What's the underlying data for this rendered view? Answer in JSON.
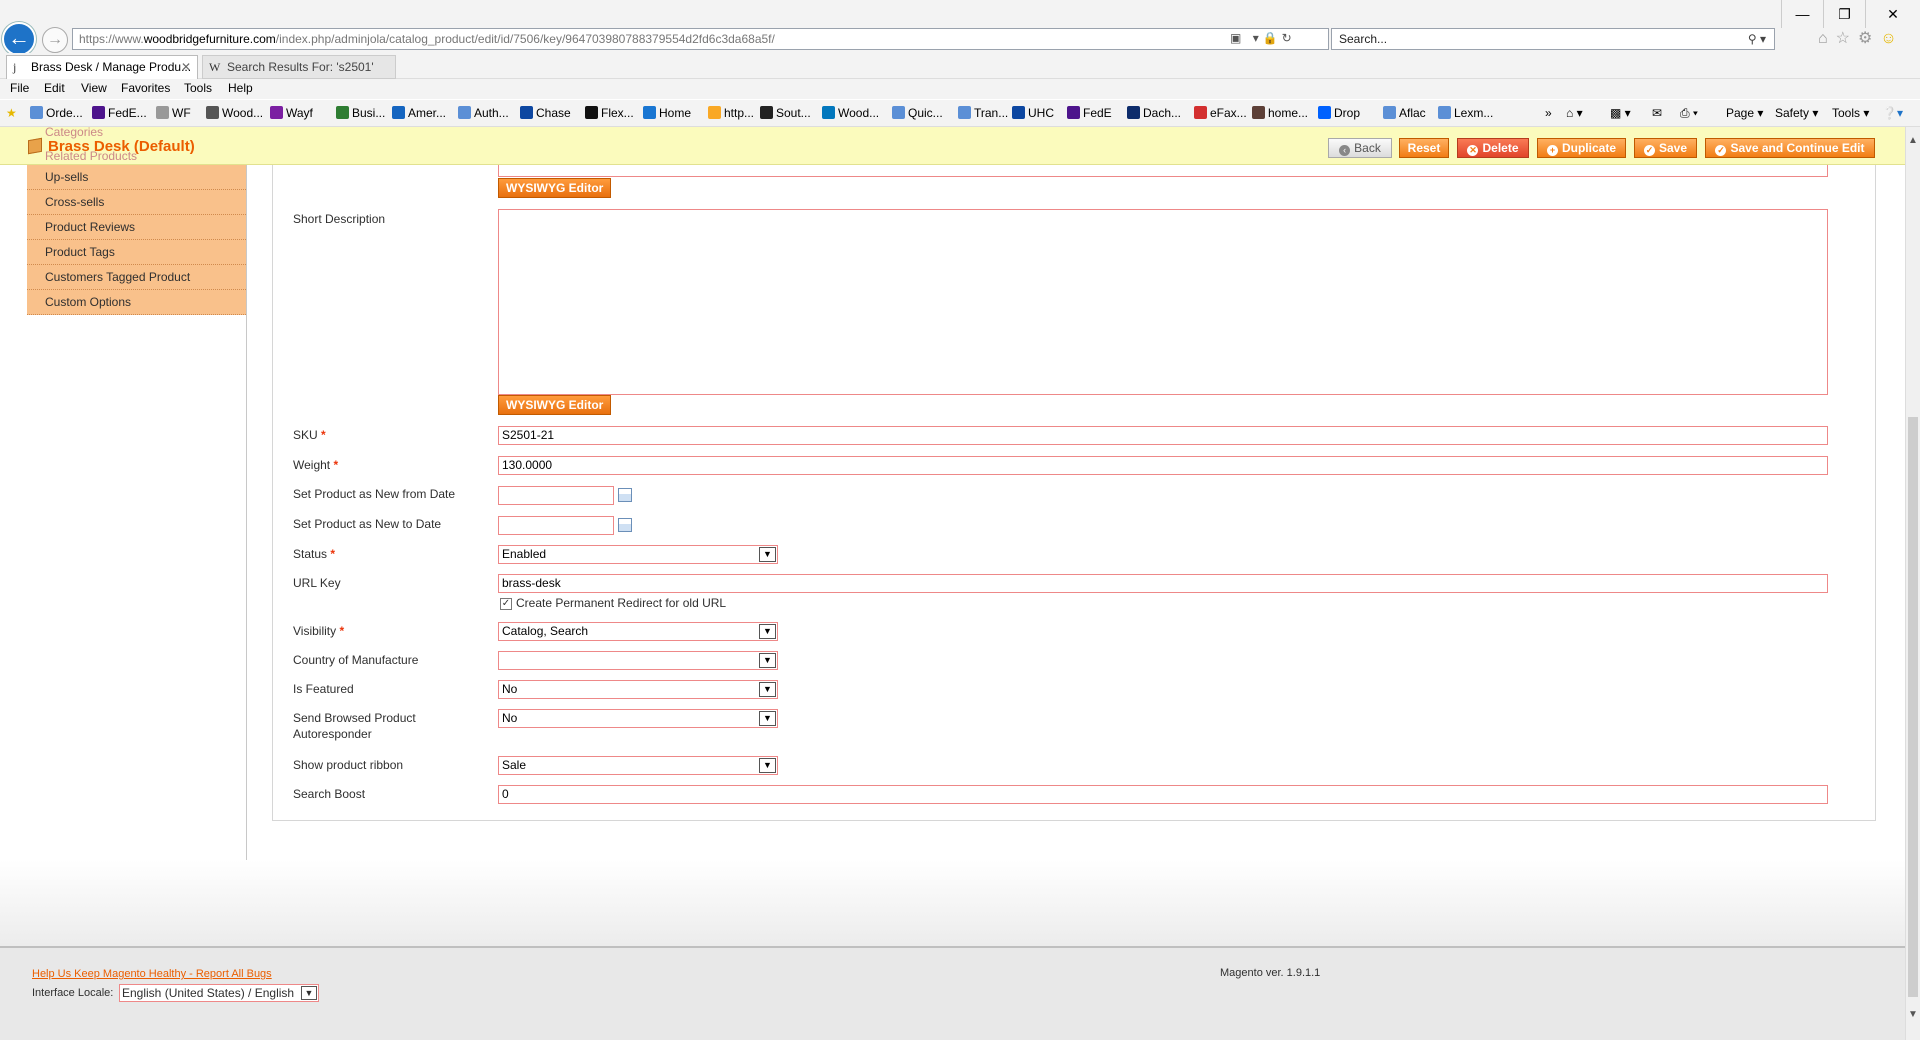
{
  "browser": {
    "url_prefix": "https://www.",
    "url_host": "woodbridgefurniture.com",
    "url_path": "/index.php/adminjola/catalog_product/edit/id/7506/key/964703980788379554d2fd6c3da68a5f/",
    "search_placeholder": "Search...",
    "tabs": [
      {
        "label": "Brass Desk / Manage Produ...",
        "favicon": "j"
      },
      {
        "label": "Search Results For: 's2501'",
        "favicon": "W"
      }
    ],
    "menu": [
      "File",
      "Edit",
      "View",
      "Favorites",
      "Tools",
      "Help"
    ],
    "favorites": [
      {
        "label": "Orde...",
        "color": "#5b8fd6"
      },
      {
        "label": "FedE...",
        "color": "#4d148c"
      },
      {
        "label": "WF",
        "color": "#999999"
      },
      {
        "label": "Wood...",
        "color": "#555555"
      },
      {
        "label": "Wayf",
        "color": "#7b1fa2"
      },
      {
        "label": "Busi...",
        "color": "#2e7d32"
      },
      {
        "label": "Amer...",
        "color": "#1565c0"
      },
      {
        "label": "Auth...",
        "color": "#5b8fd6"
      },
      {
        "label": "Chase",
        "color": "#0d47a1"
      },
      {
        "label": "Flex...",
        "color": "#111111"
      },
      {
        "label": "Home",
        "color": "#1976d2"
      },
      {
        "label": "http...",
        "color": "#f9a825"
      },
      {
        "label": "Sout...",
        "color": "#222222"
      },
      {
        "label": "Wood...",
        "color": "#0277bd"
      },
      {
        "label": "Quic...",
        "color": "#5b8fd6"
      },
      {
        "label": "Tran...",
        "color": "#5b8fd6"
      },
      {
        "label": "UHC",
        "color": "#0d47a1"
      },
      {
        "label": "FedE",
        "color": "#4d148c"
      },
      {
        "label": "Dach...",
        "color": "#0d2c6b"
      },
      {
        "label": "eFax...",
        "color": "#d32f2f"
      },
      {
        "label": "home...",
        "color": "#5d4037"
      },
      {
        "label": "Drop",
        "color": "#0061fe"
      },
      {
        "label": "Aflac",
        "color": "#5b8fd6"
      },
      {
        "label": "Lexm...",
        "color": "#5b8fd6"
      }
    ],
    "command_bar": {
      "page": "Page",
      "safety": "Safety",
      "tools": "Tools"
    }
  },
  "header": {
    "title": "Brass Desk (Default)",
    "buttons": {
      "back": "Back",
      "reset": "Reset",
      "delete": "Delete",
      "duplicate": "Duplicate",
      "save": "Save",
      "save_continue": "Save and Continue Edit"
    }
  },
  "sidebar": {
    "ghost_items": [
      "Categories",
      "Related Products"
    ],
    "items": [
      "Up-sells",
      "Cross-sells",
      "Product Reviews",
      "Product Tags",
      "Customers Tagged Product",
      "Custom Options"
    ]
  },
  "form": {
    "wysiwyg_label": "WYSIWYG Editor",
    "short_description_label": "Short Description",
    "sku": {
      "label": "SKU",
      "value": "S2501-21"
    },
    "weight": {
      "label": "Weight",
      "value": "130.0000"
    },
    "new_from_label": "Set Product as New from Date",
    "new_to_label": "Set Product as New to Date",
    "status": {
      "label": "Status",
      "value": "Enabled"
    },
    "url_key": {
      "label": "URL Key",
      "value": "brass-desk"
    },
    "redirect_label": "Create Permanent Redirect for old URL",
    "visibility": {
      "label": "Visibility",
      "value": "Catalog, Search"
    },
    "country_label": "Country of Manufacture",
    "is_featured": {
      "label": "Is Featured",
      "value": "No"
    },
    "autoresponder": {
      "label_line1": "Send Browsed Product",
      "label_line2": "Autoresponder",
      "value": "No"
    },
    "ribbon": {
      "label": "Show product ribbon",
      "value": "Sale"
    },
    "search_boost": {
      "label": "Search Boost",
      "value": "0"
    },
    "required_mark": "*"
  },
  "footer": {
    "report_link": "Help Us Keep Magento Healthy - Report All Bugs",
    "locale_label": "Interface Locale:",
    "locale_value": "English (United States) / English",
    "version": "Magento ver. 1.9.1.1"
  }
}
